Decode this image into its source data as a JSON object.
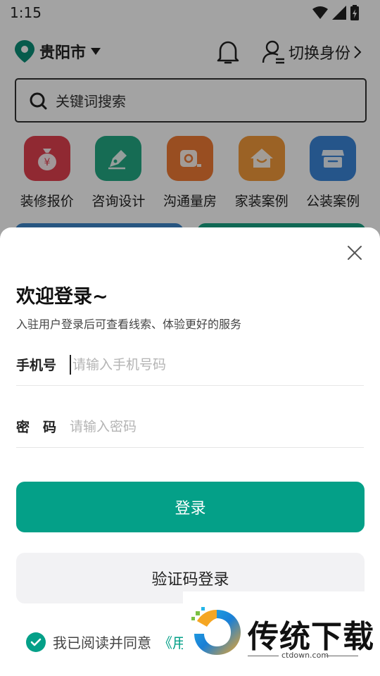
{
  "status_bar": {
    "time": "1:15"
  },
  "location": {
    "city": "贵阳市"
  },
  "switch_identity": {
    "label": "切换身份"
  },
  "search": {
    "placeholder": "关键词搜索"
  },
  "categories": [
    {
      "label": "装修报价",
      "icon": "money-bag-icon",
      "color": "#e2404f"
    },
    {
      "label": "咨询设计",
      "icon": "pen-nib-icon",
      "color": "#23a984"
    },
    {
      "label": "沟通量房",
      "icon": "tape-measure-icon",
      "color": "#ef7a35"
    },
    {
      "label": "家装案例",
      "icon": "house-icon",
      "color": "#f39a3a"
    },
    {
      "label": "公装案例",
      "icon": "store-icon",
      "color": "#3a86d8"
    }
  ],
  "login": {
    "title": "欢迎登录~",
    "subtitle": "入驻用户登录后可查看线索、体验更好的服务",
    "phone_label": "手机号",
    "phone_placeholder": "请输入手机号码",
    "password_label": "密　码",
    "password_placeholder": "请输入密码",
    "login_button": "登录",
    "code_login_button": "验证码登录",
    "agreement_text": "我已阅读并同意",
    "agreement_link": "《用"
  },
  "watermark": {
    "title": "传统下载",
    "url": "ctdown.com"
  },
  "colors": {
    "accent": "#04a088",
    "location_pin": "#0a8f78"
  }
}
